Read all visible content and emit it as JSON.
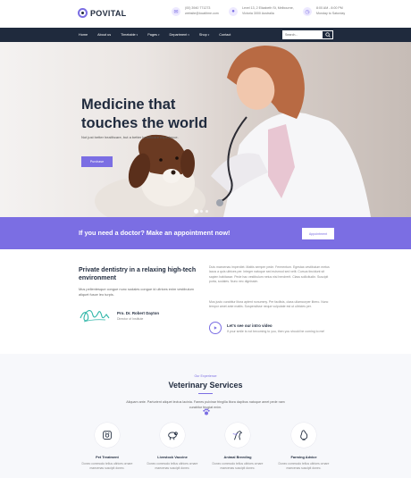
{
  "brand": {
    "name": "POVITAL"
  },
  "topbar": {
    "contact": {
      "icon": "mail-icon",
      "line1": "(00) 3940 771273",
      "line2": "website@localtime.com"
    },
    "address": {
      "icon": "location-pin-icon",
      "line1": "Level 13, 2 Elizabeth St, Melbourne,",
      "line2": "Victoria 3000 Australia"
    },
    "hours": {
      "icon": "clock-icon",
      "line1": "8:00 AM - 8:00 PM",
      "line2": "Monday to Saturday"
    }
  },
  "nav": {
    "items": [
      {
        "label": "Home",
        "has_dropdown": false
      },
      {
        "label": "About us",
        "has_dropdown": false
      },
      {
        "label": "Timetable",
        "has_dropdown": true
      },
      {
        "label": "Pages",
        "has_dropdown": true
      },
      {
        "label": "Department",
        "has_dropdown": true
      },
      {
        "label": "Shop",
        "has_dropdown": true
      },
      {
        "label": "Contact",
        "has_dropdown": false
      }
    ],
    "search": {
      "placeholder": "Search...",
      "icon": "search-icon"
    }
  },
  "hero": {
    "title": "Medicine that touches the world",
    "subtitle": "Not just better healthcare, but a better healthcare experience.",
    "button": "Purchase",
    "slides": 3,
    "active_slide": 1
  },
  "cta": {
    "text": "If you need a doctor? Make an appointment now!",
    "button": "Appointment"
  },
  "about": {
    "title": "Private dentistry in a relaxing high-tech environment",
    "description": "Mus pellentesque congue nunc sodales congue id ultrices enim vestibulum aliquet fusce leo turpis.",
    "doctor_name": "Pro. Dr. Robert Dayton",
    "doctor_role": "Director of Institute",
    "paragraph1": "Duis maecenas imperdiet. Mattis semper pede. Fermentum. Egestas vestibulum metus lacus a quis ultrices per. Integer natoque sed euismod sed velit. Cursus tincidunt sit sapien habitasse. Pede hac vestibulum netus nisi hendrerit. Class sollicitudin. Suscipit porta, sodales. Nunc nec dignissim.",
    "paragraph2": "Mus justo curabitur litora aptent nonummy. Per facilisis, class ullamcorper libero. Nunc tempor amet ante mattis. Suspendisse neque vulputate est ut ultricies per.",
    "video_title": "Let's see our intro video",
    "video_sub": "If your smile is not becoming to you, then you should be coming to me!"
  },
  "services": {
    "eyebrow": "Our Experience",
    "title": "Veterinary Services",
    "description": "Aliquam ante. Parturient aliquet lectus lacinia. Fames pulvinar fringilla litora dapibus natoque amet pede nam curabitur feugiat enim.",
    "items": [
      {
        "name": "Pet Treatment",
        "icon": "pet-care-icon",
        "text": "Donec commodo tellus ultrices ornare maecenas suscipit donec."
      },
      {
        "name": "Livestock Vaccine",
        "icon": "sheep-icon",
        "text": "Donec commodo tellus ultrices ornare maecenas suscipit donec."
      },
      {
        "name": "Animal Breeding",
        "icon": "horse-icon",
        "text": "Donec commodo tellus ultrices ornare maecenas suscipit donec."
      },
      {
        "name": "Farming Advice",
        "icon": "rooster-icon",
        "text": "Donec commodo tellus ultrices ornare maecenas suscipit donec."
      }
    ]
  },
  "colors": {
    "accent": "#7b6ee3",
    "dark": "#1f2a3d"
  }
}
